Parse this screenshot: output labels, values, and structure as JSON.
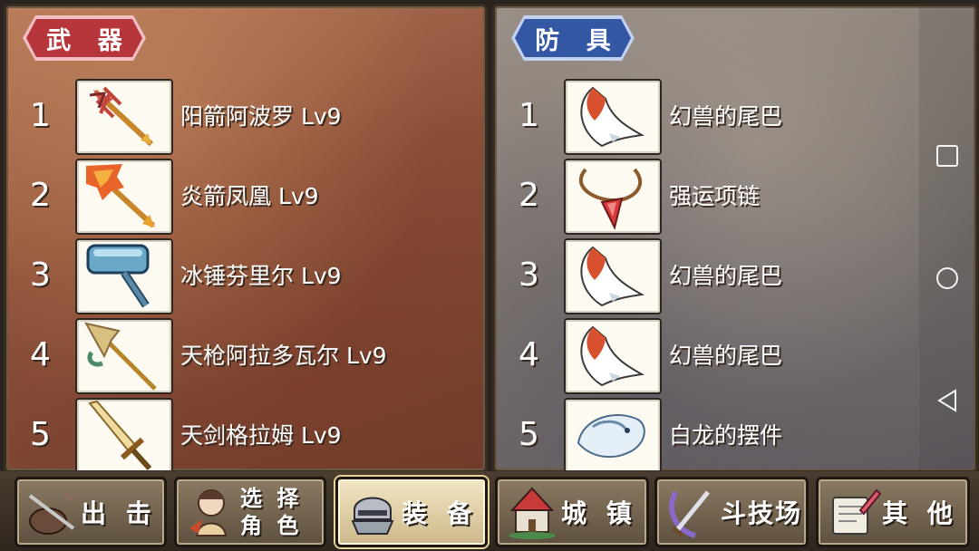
{
  "weapons": {
    "title": "武 器",
    "items": [
      {
        "num": "1",
        "name": "阳箭阿波罗 Lv9",
        "icon": "sun-arrow-icon"
      },
      {
        "num": "2",
        "name": "炎箭凤凰 Lv9",
        "icon": "flame-arrow-icon"
      },
      {
        "num": "3",
        "name": "冰锤芬里尔 Lv9",
        "icon": "ice-hammer-icon"
      },
      {
        "num": "4",
        "name": "天枪阿拉多瓦尔 Lv9",
        "icon": "heaven-spear-icon"
      },
      {
        "num": "5",
        "name": "天剑格拉姆 Lv9",
        "icon": "heaven-sword-icon"
      }
    ]
  },
  "armor": {
    "title": "防 具",
    "items": [
      {
        "num": "1",
        "name": "幻兽的尾巴",
        "icon": "beast-tail-icon"
      },
      {
        "num": "2",
        "name": "强运项链",
        "icon": "luck-necklace-icon"
      },
      {
        "num": "3",
        "name": "幻兽的尾巴",
        "icon": "beast-tail-icon"
      },
      {
        "num": "4",
        "name": "幻兽的尾巴",
        "icon": "beast-tail-icon"
      },
      {
        "num": "5",
        "name": "白龙的摆件",
        "icon": "white-dragon-ornament-icon"
      }
    ]
  },
  "tabs": [
    {
      "label": "出 击",
      "icon": "sortie-icon",
      "active": false
    },
    {
      "label": "选择角色",
      "line1": "选 择",
      "line2": "角 色",
      "icon": "character-select-icon",
      "active": false
    },
    {
      "label": "装 备",
      "icon": "equipment-icon",
      "active": true
    },
    {
      "label": "城 镇",
      "icon": "town-icon",
      "active": false
    },
    {
      "label": "斗技场",
      "icon": "arena-icon",
      "active": false
    },
    {
      "label": "其 他",
      "icon": "other-icon",
      "active": false
    }
  ],
  "system_nav": {
    "recent_icon": "recent-apps-icon",
    "home_icon": "home-icon",
    "back_icon": "back-icon"
  }
}
